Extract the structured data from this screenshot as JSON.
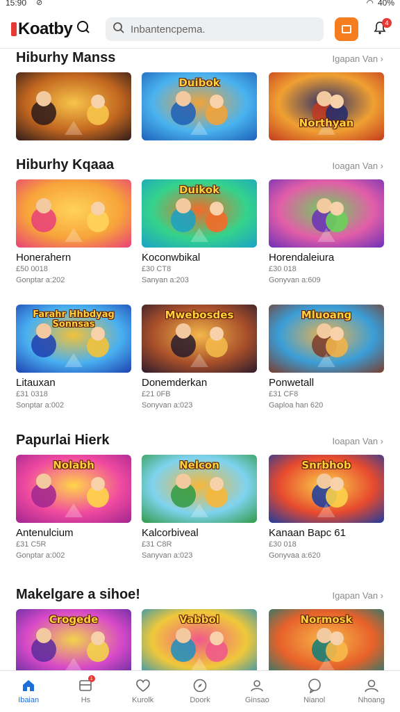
{
  "status": {
    "time": "15:90",
    "battery": "40%"
  },
  "header": {
    "logo": "Koatby",
    "search_placeholder": "Inbantencpema.",
    "notif_count": "4"
  },
  "sections": [
    {
      "title": "Hiburhy Manss",
      "more": "Igapan Van ›",
      "cards": [
        {
          "title": "",
          "meta": "",
          "date": "",
          "palette": [
            "#2b1a1a",
            "#c2661f",
            "#f7c44a"
          ]
        },
        {
          "title": "",
          "meta": "",
          "date": "",
          "palette": [
            "#1c5fb8",
            "#4ab3ef",
            "#f0a33b"
          ]
        },
        {
          "title": "",
          "meta": "",
          "date": "",
          "palette": [
            "#c23a1e",
            "#f0a032",
            "#2a2d6a"
          ]
        }
      ]
    },
    {
      "title": "Hiburhy Kqaaa",
      "more": "Ioagan Van ›",
      "cards": [
        {
          "title": "Honerahern",
          "meta": "£50 0018",
          "date": "Gonptar a:202",
          "palette": [
            "#e93e7a",
            "#f7a43a",
            "#ffd35a"
          ]
        },
        {
          "title": "Koconwbikal",
          "meta": "£30 CT8",
          "date": "Sanyan a:203",
          "palette": [
            "#1aa1c7",
            "#34d38b",
            "#f26a2a"
          ]
        },
        {
          "title": "Horendaleiura",
          "meta": "£30 018",
          "date": "Gonyvan a:609",
          "palette": [
            "#6b2fb8",
            "#e25ea8",
            "#6bd25a"
          ]
        }
      ]
    },
    {
      "title": "",
      "more": "",
      "cards": [
        {
          "title": "Litauxan",
          "meta": "£31 0318",
          "date": "Sonptar a:002",
          "palette": [
            "#1d3fb0",
            "#49b0f0",
            "#f2c23a"
          ]
        },
        {
          "title": "Donemderkan",
          "meta": "£21 0FB",
          "date": "Sonyvan a:023",
          "palette": [
            "#2a1b2c",
            "#a84f2a",
            "#f3b84a"
          ]
        },
        {
          "title": "Ponwetall",
          "meta": "£31 CF8",
          "date": "Gaploa han 620",
          "palette": [
            "#7a3b2a",
            "#3a9ed8",
            "#f0b24a"
          ]
        }
      ]
    },
    {
      "title": "Papurlai Hierk",
      "more": "Ioapan Van ›",
      "cards": [
        {
          "title": "Antenulcium",
          "meta": "£31 C5R",
          "date": "Gonptar a:002",
          "palette": [
            "#a0248f",
            "#f04aa0",
            "#ffd54a"
          ]
        },
        {
          "title": "Kalcorbiveal",
          "meta": "£31 C8R",
          "date": "Sanyvan a:023",
          "palette": [
            "#2f9a44",
            "#7ed3ef",
            "#f6b73a"
          ]
        },
        {
          "title": "Kanaan Bapc 61",
          "meta": "£30 018",
          "date": "Gonyvaa a:620",
          "palette": [
            "#1a3ca0",
            "#e74a2e",
            "#fbd24a"
          ]
        }
      ]
    },
    {
      "title": "Makelgare a sihoe!",
      "more": "Igapan Van ›",
      "cards": [
        {
          "title": "",
          "meta": "",
          "date": "",
          "palette": [
            "#5a2a9e",
            "#d84ac8",
            "#f2d34a"
          ]
        },
        {
          "title": "",
          "meta": "",
          "date": "",
          "palette": [
            "#1d8fc0",
            "#f0c83a",
            "#f05a8a"
          ]
        },
        {
          "title": "",
          "meta": "",
          "date": "",
          "palette": [
            "#0f7c78",
            "#e7612a",
            "#f7b94a"
          ]
        }
      ]
    }
  ],
  "thumb_text": [
    "",
    "Duibok",
    "Northyan",
    "",
    "Duikok",
    "",
    "Farahr Hhbdyag Sonnsas",
    "Mwebosdes",
    "Mluoang",
    "Nolabh",
    "Nelcon",
    "Snrbhob",
    "Crogede",
    "Vabbol",
    "Normosk"
  ],
  "nav": [
    {
      "label": "Ibaian",
      "icon": "home-icon",
      "active": true
    },
    {
      "label": "Hs",
      "icon": "inbox-icon",
      "badge": "1"
    },
    {
      "label": "Kurolk",
      "icon": "heart-icon"
    },
    {
      "label": "Doork",
      "icon": "compass-icon"
    },
    {
      "label": "Ginsao",
      "icon": "person-icon"
    },
    {
      "label": "Nianol",
      "icon": "chat-icon"
    },
    {
      "label": "Nhoang",
      "icon": "profile-icon"
    }
  ],
  "colors": {
    "accent_orange": "#f57c1f",
    "accent_blue": "#1e6fd9",
    "badge_red": "#e53935"
  }
}
